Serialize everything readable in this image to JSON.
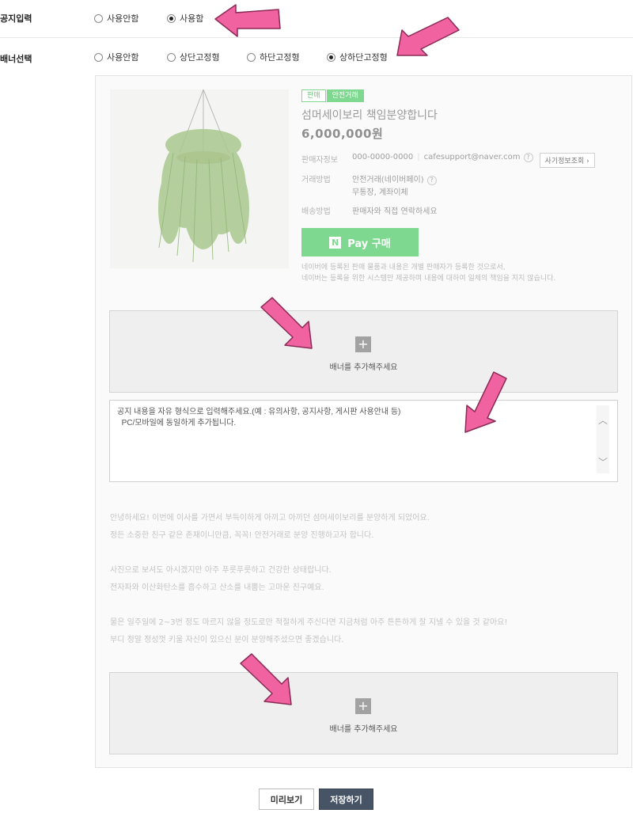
{
  "notice_input": {
    "label": "공지입력",
    "options": [
      {
        "label": "사용안함",
        "checked": false
      },
      {
        "label": "사용함",
        "checked": true
      }
    ]
  },
  "banner_select": {
    "label": "배너선택",
    "options": [
      {
        "label": "사용안함",
        "checked": false
      },
      {
        "label": "상단고정형",
        "checked": false
      },
      {
        "label": "하단고정형",
        "checked": false
      },
      {
        "label": "상하단고정형",
        "checked": true
      }
    ]
  },
  "product": {
    "badge_sale": "판매",
    "badge_safe": "안전거래",
    "title": "섬머세이보리 책임분양합니다",
    "price": "6,000,000원",
    "seller_key": "판매자정보",
    "seller_phone": "000-0000-0000",
    "seller_email": "cafesupport@naver.com",
    "fraud_button": "사기정보조회",
    "trade_key": "거래방법",
    "trade_value": "안전거래(네이버페이)",
    "trade_value2": "무통장, 계좌이체",
    "ship_key": "배송방법",
    "ship_value": "판매자와 직접 연락하세요",
    "pay_button": "Pay 구매",
    "pay_logo": "N",
    "disclaimer1": "네이버에 등록된 판매 물품과 내용은 개별 판매자가 등록한 것으로서,",
    "disclaimer2": "네이버는 등록을 위한 시스템만 제공하며 내용에 대하여 일체의 책임을 지지 않습니다."
  },
  "banner_top": {
    "text": "배너를 추가해주세요"
  },
  "banner_bottom": {
    "text": "배너를 추가해주세요"
  },
  "notice_text": "공지 내용을 자유 형식으로 입력해주세요.(예 : 유의사항, 공지사항, 게시판 사용안내 등)\n  PC/모바일에 동일하게 추가됩니다.",
  "body_lines": [
    "안녕하세요! 이번에 이사를 가면서 부득이하게 아끼고 아끼던 섬머세이보리를 분양하게 되었어요.",
    "정든 소중한 친구 같은 존재이니만큼, 꼭꼭! 안전거래로 분양 진행하고자 합니다.",
    "",
    "사진으로 보셔도 아시겠지만 아주 푸릇푸릇하고 건강한 상태랍니다.",
    "전자파와 이산화탄소를 흡수하고 산소를 내뿜는 고마운 친구예요.",
    "",
    "물은 일주일에 2~3번 정도 마르지 않을 정도로만 적절하게 주신다면 지금처럼 아주 튼튼하게 잘 지낼 수 있을 것 같아요!",
    "부디 정말 정성껏 키울 자신이 있으신 분이 분양해주셨으면 좋겠습니다."
  ],
  "buttons": {
    "preview": "미리보기",
    "save": "저장하기"
  },
  "colors": {
    "accent_green": "#7ed88f",
    "save_button": "#475466",
    "arrow_pink": "#f062a0"
  }
}
